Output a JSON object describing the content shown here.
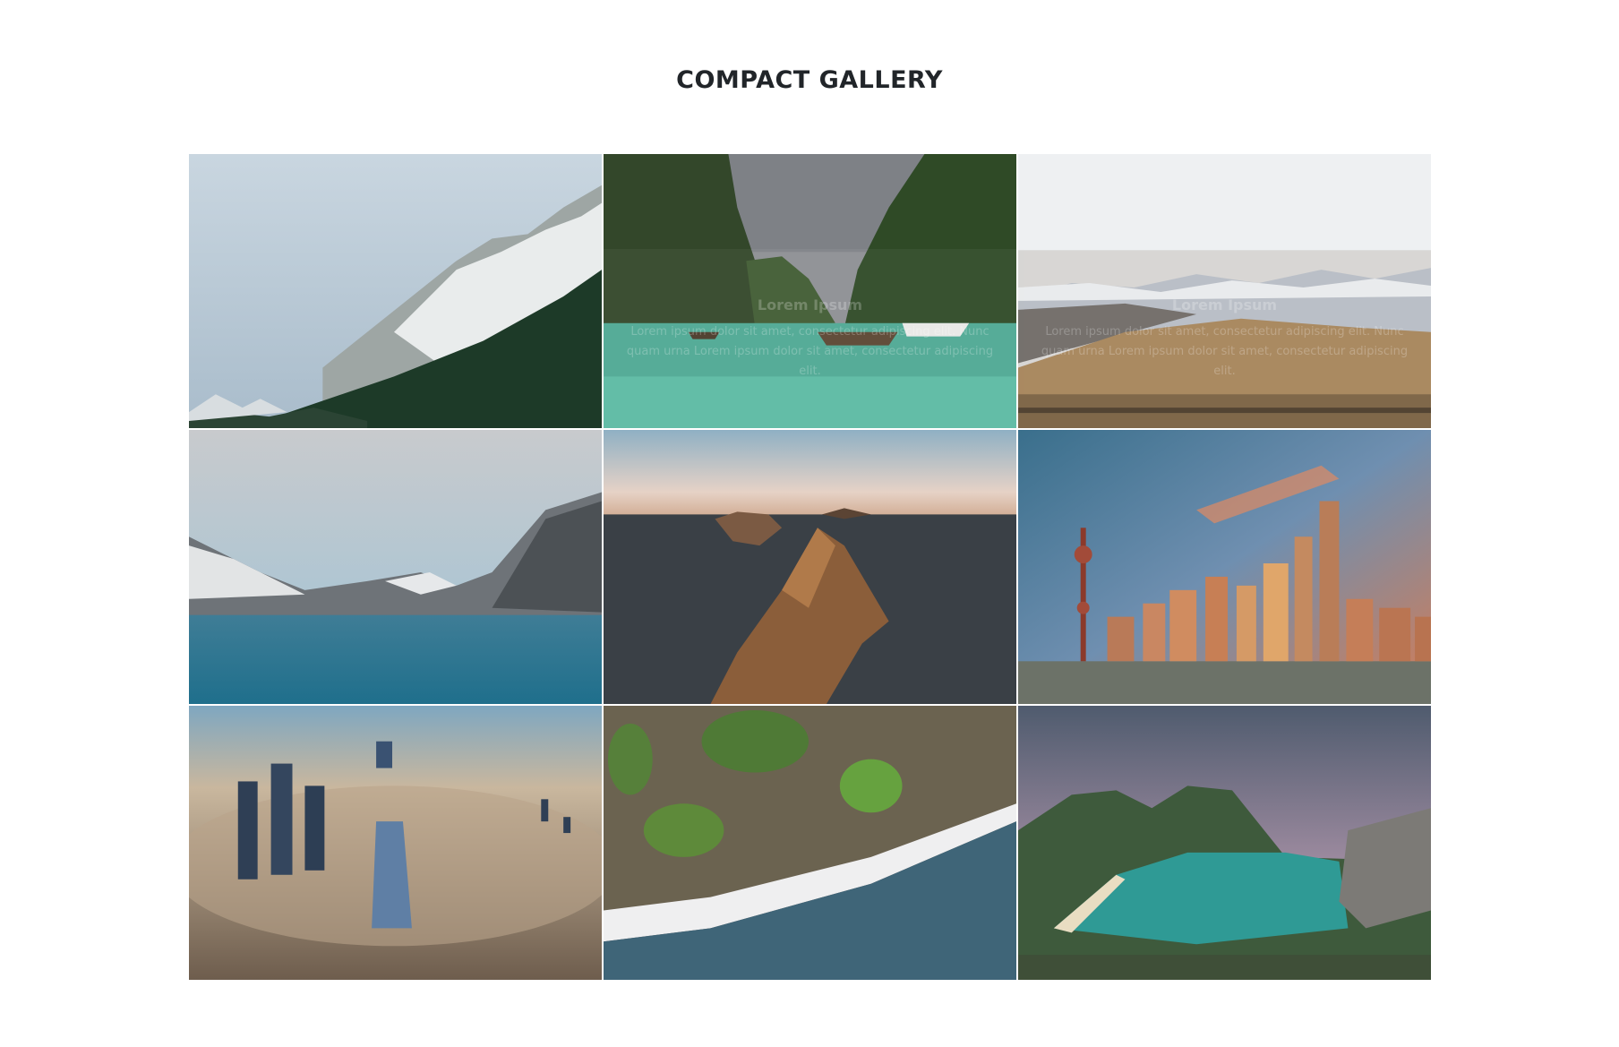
{
  "page": {
    "title": "COMPACT GALLERY"
  },
  "gallery": {
    "items": [
      {
        "scene": "snowy-mountain-forest-photo",
        "overlay_visible": false,
        "caption_title": "",
        "caption_text": ""
      },
      {
        "scene": "tropical-lagoon-boats-photo",
        "overlay_visible": true,
        "caption_title": "Lorem Ipsum",
        "caption_text": "Lorem ipsum dolor sit amet, consectetur adipiscing elit. Nunc quam urna Lorem ipsum dolor sit amet, consectetur adipiscing elit."
      },
      {
        "scene": "golden-field-mountains-photo",
        "overlay_visible": true,
        "caption_title": "Lorem Ipsum",
        "caption_text": "Lorem ipsum dolor sit amet, consectetur adipiscing elit. Nunc quam urna Lorem ipsum dolor sit amet, consectetur adipiscing elit."
      },
      {
        "scene": "mountain-lake-photo",
        "overlay_visible": false,
        "caption_title": "",
        "caption_text": ""
      },
      {
        "scene": "sea-rock-islands-photo",
        "overlay_visible": false,
        "caption_title": "",
        "caption_text": ""
      },
      {
        "scene": "city-skyline-sunset-photo",
        "overlay_visible": false,
        "caption_title": "",
        "caption_text": ""
      },
      {
        "scene": "skyscrapers-in-clouds-photo",
        "overlay_visible": false,
        "caption_title": "",
        "caption_text": ""
      },
      {
        "scene": "aerial-coastline-photo",
        "overlay_visible": false,
        "caption_title": "",
        "caption_text": ""
      },
      {
        "scene": "fjord-beach-cliffs-photo",
        "overlay_visible": false,
        "caption_title": "",
        "caption_text": ""
      }
    ]
  }
}
